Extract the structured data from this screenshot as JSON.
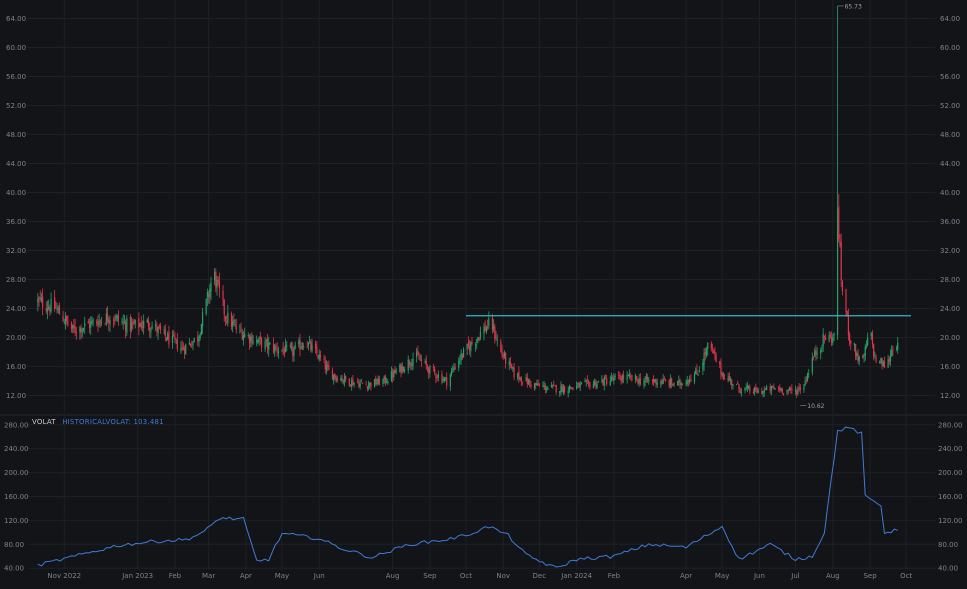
{
  "colors": {
    "background": "#131417",
    "grid": "#1e2026",
    "up": "#26a069",
    "down": "#e0344d",
    "resistance_line": "#31b7c2",
    "indicator": "#3f7bd8",
    "axis_text": "#7d828d"
  },
  "chart_data": [
    {
      "type": "candlestick",
      "title": "",
      "xlabel": "",
      "ylabel": "",
      "ylim": [
        10,
        66
      ],
      "y_ticks": [
        "12.00",
        "16.00",
        "20.00",
        "24.00",
        "28.00",
        "32.00",
        "36.00",
        "40.00",
        "44.00",
        "48.00",
        "52.00",
        "56.00",
        "60.00",
        "64.00"
      ],
      "x_ticks": [
        "Nov 2022",
        "Jan 2023",
        "Feb",
        "Mar",
        "Apr",
        "May",
        "Jun",
        "Aug",
        "Sep",
        "Oct",
        "Nov",
        "Dec",
        "Jan 2024",
        "Feb",
        "Apr",
        "May",
        "Jun",
        "Jul",
        "Aug",
        "Sep",
        "Oct"
      ],
      "x_tick_dates": [
        "2022-11-01",
        "2023-01-01",
        "2023-02-01",
        "2023-03-01",
        "2023-04-01",
        "2023-05-01",
        "2023-06-01",
        "2023-08-01",
        "2023-09-01",
        "2023-10-01",
        "2023-11-01",
        "2023-12-01",
        "2024-01-01",
        "2024-02-01",
        "2024-04-01",
        "2024-05-01",
        "2024-06-01",
        "2024-07-01",
        "2024-08-01",
        "2024-09-01",
        "2024-10-01"
      ],
      "date_range": [
        "2022-10-10",
        "2024-09-24"
      ],
      "close_path": [
        [
          "2022-10-10",
          25.0
        ],
        [
          "2022-10-25",
          24.0
        ],
        [
          "2022-11-08",
          21.0
        ],
        [
          "2022-11-25",
          22.0
        ],
        [
          "2022-12-10",
          23.0
        ],
        [
          "2022-12-25",
          21.5
        ],
        [
          "2023-01-10",
          22.0
        ],
        [
          "2023-01-25",
          20.0
        ],
        [
          "2023-02-08",
          18.5
        ],
        [
          "2023-02-20",
          20.0
        ],
        [
          "2023-03-01",
          26.0
        ],
        [
          "2023-03-05",
          29.0
        ],
        [
          "2023-03-15",
          23.0
        ],
        [
          "2023-03-25",
          21.0
        ],
        [
          "2023-04-10",
          19.5
        ],
        [
          "2023-04-25",
          18.5
        ],
        [
          "2023-05-10",
          18.0
        ],
        [
          "2023-05-20",
          19.5
        ],
        [
          "2023-05-31",
          17.5
        ],
        [
          "2023-06-10",
          15.0
        ],
        [
          "2023-06-25",
          14.0
        ],
        [
          "2023-07-10",
          13.5
        ],
        [
          "2023-07-25",
          14.0
        ],
        [
          "2023-08-10",
          16.0
        ],
        [
          "2023-08-20",
          17.5
        ],
        [
          "2023-09-01",
          15.5
        ],
        [
          "2023-09-15",
          14.0
        ],
        [
          "2023-09-25",
          17.0
        ],
        [
          "2023-10-05",
          19.0
        ],
        [
          "2023-10-15",
          21.0
        ],
        [
          "2023-10-22",
          22.0
        ],
        [
          "2023-10-30",
          18.0
        ],
        [
          "2023-11-10",
          15.0
        ],
        [
          "2023-11-25",
          13.5
        ],
        [
          "2023-12-10",
          13.0
        ],
        [
          "2023-12-25",
          13.0
        ],
        [
          "2024-01-10",
          13.5
        ],
        [
          "2024-01-25",
          14.0
        ],
        [
          "2024-02-10",
          14.5
        ],
        [
          "2024-02-25",
          14.0
        ],
        [
          "2024-03-10",
          14.0
        ],
        [
          "2024-03-25",
          13.5
        ],
        [
          "2024-04-10",
          15.0
        ],
        [
          "2024-04-20",
          19.0
        ],
        [
          "2024-05-01",
          15.0
        ],
        [
          "2024-05-15",
          13.0
        ],
        [
          "2024-05-31",
          12.5
        ],
        [
          "2024-06-15",
          13.0
        ],
        [
          "2024-06-30",
          12.5
        ],
        [
          "2024-07-08",
          13.5
        ],
        [
          "2024-07-15",
          17.0
        ],
        [
          "2024-07-25",
          20.0
        ],
        [
          "2024-08-02",
          20.0
        ],
        [
          "2024-08-05",
          38.0
        ],
        [
          "2024-08-08",
          28.0
        ],
        [
          "2024-08-15",
          20.0
        ],
        [
          "2024-08-25",
          16.0
        ],
        [
          "2024-09-01",
          21.0
        ],
        [
          "2024-09-05",
          17.0
        ],
        [
          "2024-09-15",
          16.0
        ],
        [
          "2024-09-22",
          20.0
        ],
        [
          "2024-09-24",
          18.5
        ]
      ],
      "spikes": [
        {
          "date": "2024-08-05",
          "high": 65.73,
          "low": 23.0
        }
      ],
      "resistance_line": {
        "y": 23.0,
        "from": "2023-10-01",
        "to": "2024-10-05"
      },
      "annotations": [
        {
          "label": "65.73",
          "date": "2024-08-05",
          "value": 65.73
        },
        {
          "label": "10.62",
          "date": "2024-07-05",
          "value": 10.62
        }
      ]
    },
    {
      "type": "line",
      "title": "",
      "ylim": [
        37,
        288
      ],
      "y_ticks": [
        "40.00",
        "80.00",
        "120.00",
        "160.00",
        "200.00",
        "240.00",
        "280.00"
      ],
      "series": [
        {
          "name": "HISTORICALVOLAT",
          "last_value": "103.481",
          "points": [
            [
              "2022-10-10",
              45
            ],
            [
              "2022-11-10",
              60
            ],
            [
              "2022-12-15",
              78
            ],
            [
              "2023-01-15",
              85
            ],
            [
              "2023-02-10",
              88
            ],
            [
              "2023-02-25",
              100
            ],
            [
              "2023-03-10",
              124
            ],
            [
              "2023-03-30",
              122
            ],
            [
              "2023-04-10",
              52
            ],
            [
              "2023-04-20",
              55
            ],
            [
              "2023-05-01",
              98
            ],
            [
              "2023-05-31",
              90
            ],
            [
              "2023-06-20",
              73
            ],
            [
              "2023-07-15",
              58
            ],
            [
              "2023-08-15",
              80
            ],
            [
              "2023-09-15",
              88
            ],
            [
              "2023-10-01",
              95
            ],
            [
              "2023-10-20",
              110
            ],
            [
              "2023-11-05",
              95
            ],
            [
              "2023-11-20",
              62
            ],
            [
              "2023-12-01",
              52
            ],
            [
              "2023-12-15",
              40
            ],
            [
              "2024-01-01",
              55
            ],
            [
              "2024-02-01",
              60
            ],
            [
              "2024-03-01",
              80
            ],
            [
              "2024-04-01",
              75
            ],
            [
              "2024-05-01",
              110
            ],
            [
              "2024-05-15",
              55
            ],
            [
              "2024-06-10",
              80
            ],
            [
              "2024-07-01",
              55
            ],
            [
              "2024-07-15",
              60
            ],
            [
              "2024-07-25",
              100
            ],
            [
              "2024-08-05",
              270
            ],
            [
              "2024-08-15",
              275
            ],
            [
              "2024-08-25",
              265
            ],
            [
              "2024-08-28",
              160
            ],
            [
              "2024-09-10",
              145
            ],
            [
              "2024-09-13",
              100
            ],
            [
              "2024-09-24",
              103.481
            ]
          ]
        }
      ]
    }
  ]
}
